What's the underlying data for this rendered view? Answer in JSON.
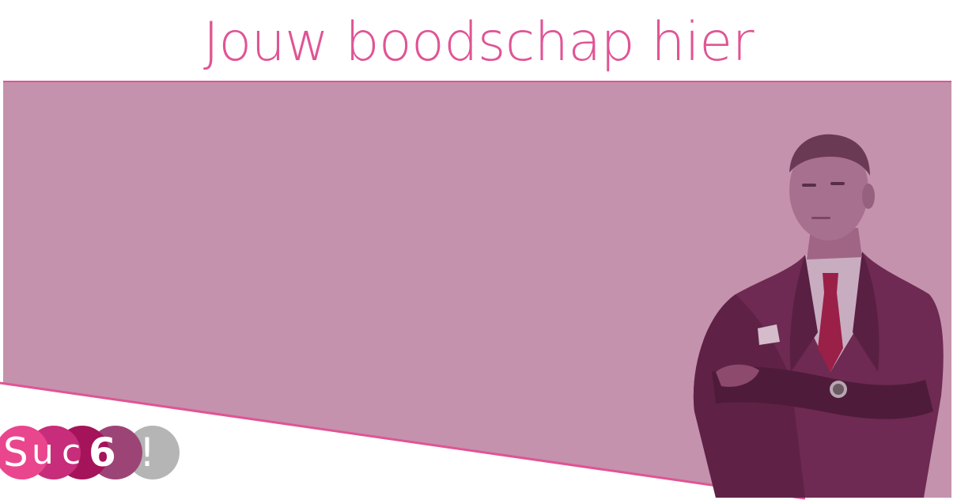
{
  "headline": {
    "text": "Jouw boodschap hier"
  },
  "colors": {
    "accent": "#e05494",
    "panel": "#c492ad",
    "logo_pink": "#e9468e",
    "logo_magenta": "#c72d7a",
    "logo_crimson": "#a5135a",
    "logo_purple": "#9d4477",
    "logo_gray": "#b5b5b5"
  },
  "logo": {
    "brand_s": "S",
    "brand_u": "u",
    "brand_c": "c",
    "brand_six": "6",
    "brand_excl": "!"
  }
}
